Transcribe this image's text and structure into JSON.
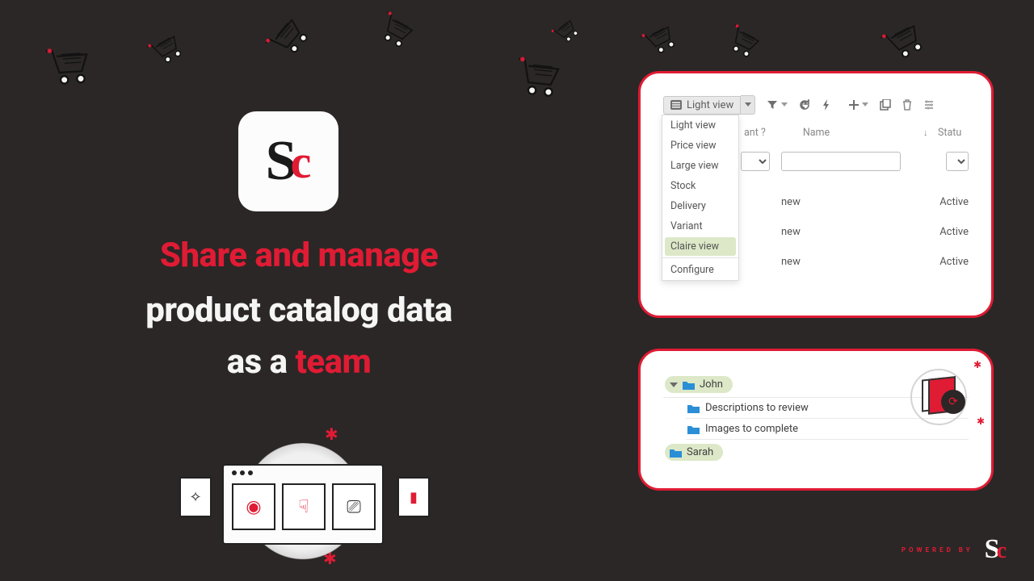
{
  "headline": {
    "line1": "Share and manage",
    "line2": "product catalog data",
    "line3_prefix": "as a ",
    "line3_emph": "team"
  },
  "panel1": {
    "toolbar": {
      "view_label": "Light view"
    },
    "menu": {
      "items": [
        "Light view",
        "Price view",
        "Large view",
        "Stock",
        "Delivery",
        "Variant",
        "Claire view"
      ],
      "selected": "Claire view",
      "configure": "Configure"
    },
    "columns": {
      "variant_suffix": "ant ?",
      "name": "Name",
      "status": "Statu"
    },
    "rows": [
      {
        "name": "new",
        "status": "Active"
      },
      {
        "name": "new",
        "status": "Active"
      },
      {
        "name": "new",
        "status": "Active"
      }
    ]
  },
  "panel2": {
    "tree": {
      "john": "John",
      "children": [
        "Descriptions to review",
        "Images to complete"
      ],
      "sarah": "Sarah"
    }
  },
  "footer": {
    "powered": "POWERED BY"
  }
}
